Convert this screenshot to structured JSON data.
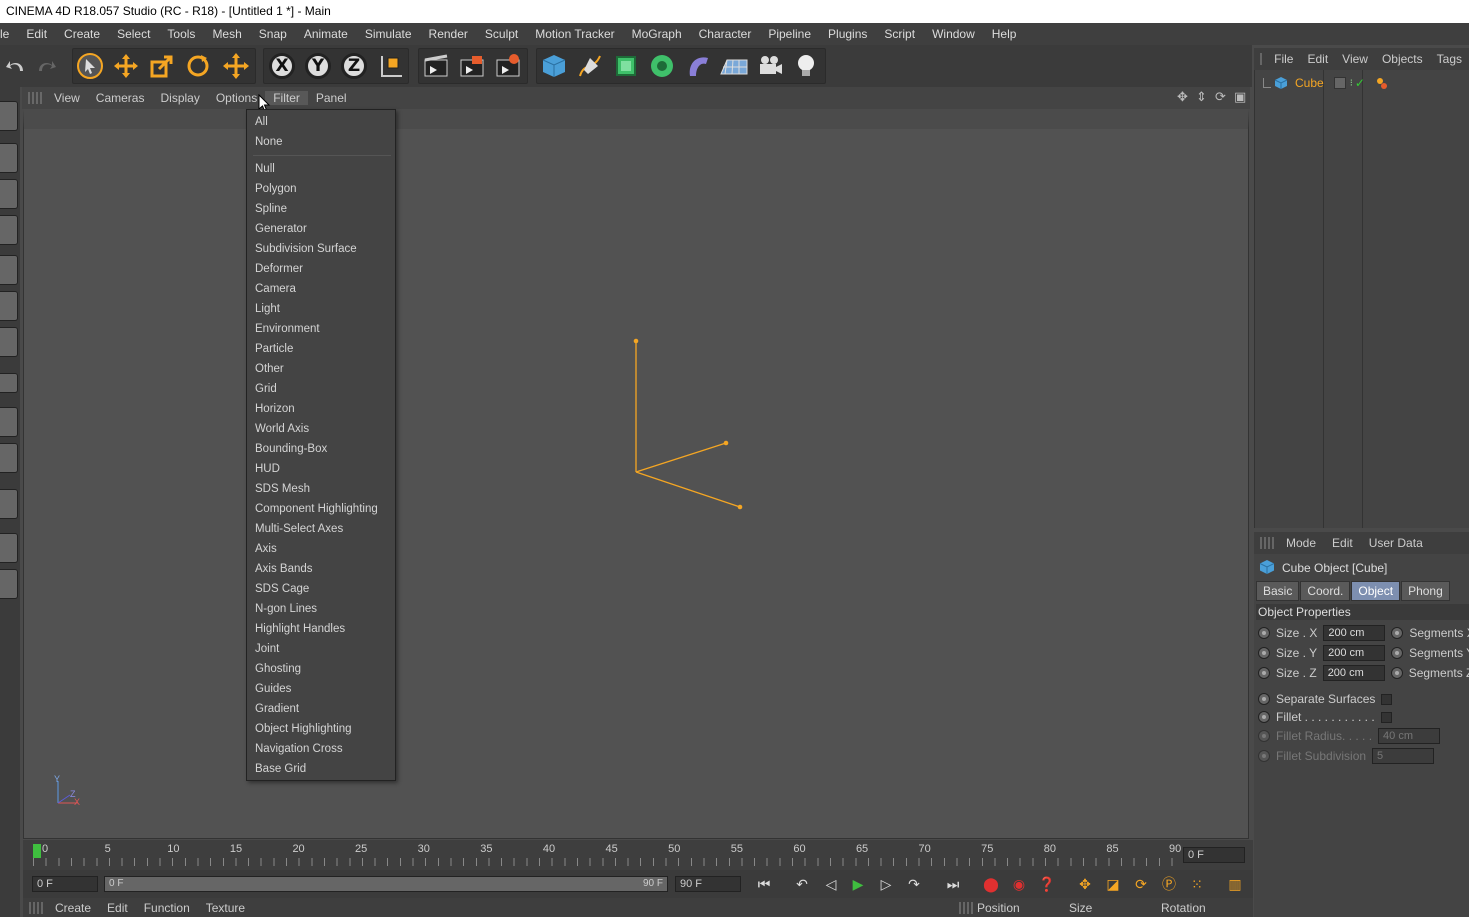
{
  "window": {
    "title": "CINEMA 4D R18.057 Studio (RC - R18) - [Untitled 1 *] - Main"
  },
  "menubar": [
    "le",
    "Edit",
    "Create",
    "Select",
    "Tools",
    "Mesh",
    "Snap",
    "Animate",
    "Simulate",
    "Render",
    "Sculpt",
    "Motion Tracker",
    "MoGraph",
    "Character",
    "Pipeline",
    "Plugins",
    "Script",
    "Window",
    "Help"
  ],
  "toolbar": {
    "axis_x": "X",
    "axis_y": "Y",
    "axis_z": "Z"
  },
  "viewport": {
    "menu": [
      "View",
      "Cameras",
      "Display",
      "Options",
      "Filter",
      "Panel"
    ],
    "axis_labels": {
      "y": "Y",
      "x": "X",
      "z": "Z"
    },
    "accent": "#f5a623"
  },
  "filter_menu": {
    "group1": [
      "All",
      "None"
    ],
    "group2": [
      "Null",
      "Polygon",
      "Spline",
      "Generator",
      "Subdivision Surface",
      "Deformer",
      "Camera",
      "Light",
      "Environment",
      "Particle",
      "Other",
      "Grid",
      "Horizon",
      "World Axis",
      "Bounding-Box",
      "HUD",
      "SDS Mesh",
      "Component Highlighting",
      "Multi-Select Axes",
      "Axis",
      "Axis Bands",
      "SDS Cage",
      "N-gon Lines",
      "Highlight Handles",
      "Joint",
      "Ghosting",
      "Guides",
      "Gradient",
      "Object Highlighting",
      "Navigation Cross",
      "Base Grid"
    ]
  },
  "object_manager": {
    "menu": [
      "File",
      "Edit",
      "View",
      "Objects",
      "Tags"
    ],
    "object_name": "Cube"
  },
  "attributes": {
    "menu": [
      "Mode",
      "Edit",
      "User Data"
    ],
    "title": "Cube Object [Cube]",
    "tabs": [
      "Basic",
      "Coord.",
      "Object",
      "Phong"
    ],
    "active_tab": "Object",
    "section": "Object Properties",
    "size_x_label": "Size . X",
    "size_x": "200 cm",
    "seg_x_label": "Segments X",
    "size_y_label": "Size . Y",
    "size_y": "200 cm",
    "seg_y_label": "Segments Y",
    "size_z_label": "Size . Z",
    "size_z": "200 cm",
    "seg_z_label": "Segments Z",
    "separate_label": "Separate Surfaces",
    "fillet_label": "Fillet . . . . . . . . . . .",
    "fillet_radius_label": "Fillet Radius. . . . .",
    "fillet_radius": "40 cm",
    "fillet_sub_label": "Fillet Subdivision",
    "fillet_sub": "5"
  },
  "timeline": {
    "ticks": [
      "0",
      "5",
      "10",
      "15",
      "20",
      "25",
      "30",
      "35",
      "40",
      "45",
      "50",
      "55",
      "60",
      "65",
      "70",
      "75",
      "80",
      "85",
      "90"
    ],
    "current_frame": "0 F"
  },
  "transport": {
    "start": "0 F",
    "slider_start": "0 F",
    "slider_end": "90 F",
    "end": "90 F"
  },
  "bottom": {
    "material_menu": [
      "Create",
      "Edit",
      "Function",
      "Texture"
    ],
    "coords": [
      "Position",
      "Size",
      "Rotation"
    ]
  }
}
